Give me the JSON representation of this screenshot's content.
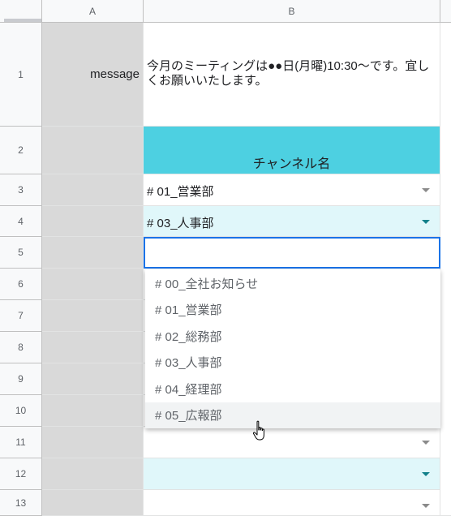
{
  "columns": [
    "A",
    "B"
  ],
  "rows": [
    "1",
    "2",
    "3",
    "4",
    "5",
    "6",
    "7",
    "8",
    "9",
    "10",
    "11",
    "12",
    "13"
  ],
  "cells": {
    "a1": "message",
    "b1": "今月のミーティングは●●日(月曜)10:30～です。宜しくお願いいたします。",
    "b2": "チャンネル名",
    "b3": "# 01_営業部",
    "b4": "# 03_人事部"
  },
  "dropdown": {
    "options": [
      "# 00_全社お知らせ",
      "# 01_営業部",
      "# 02_総務部",
      "# 03_人事部",
      "# 04_経理部",
      "# 05_広報部"
    ],
    "hovered_index": 5
  },
  "colors": {
    "header_bg": "#4dd0e1",
    "alt_row_bg": "#e0f7fa",
    "column_a_bg": "#d9d9d9",
    "active_border": "#1a73e8"
  }
}
